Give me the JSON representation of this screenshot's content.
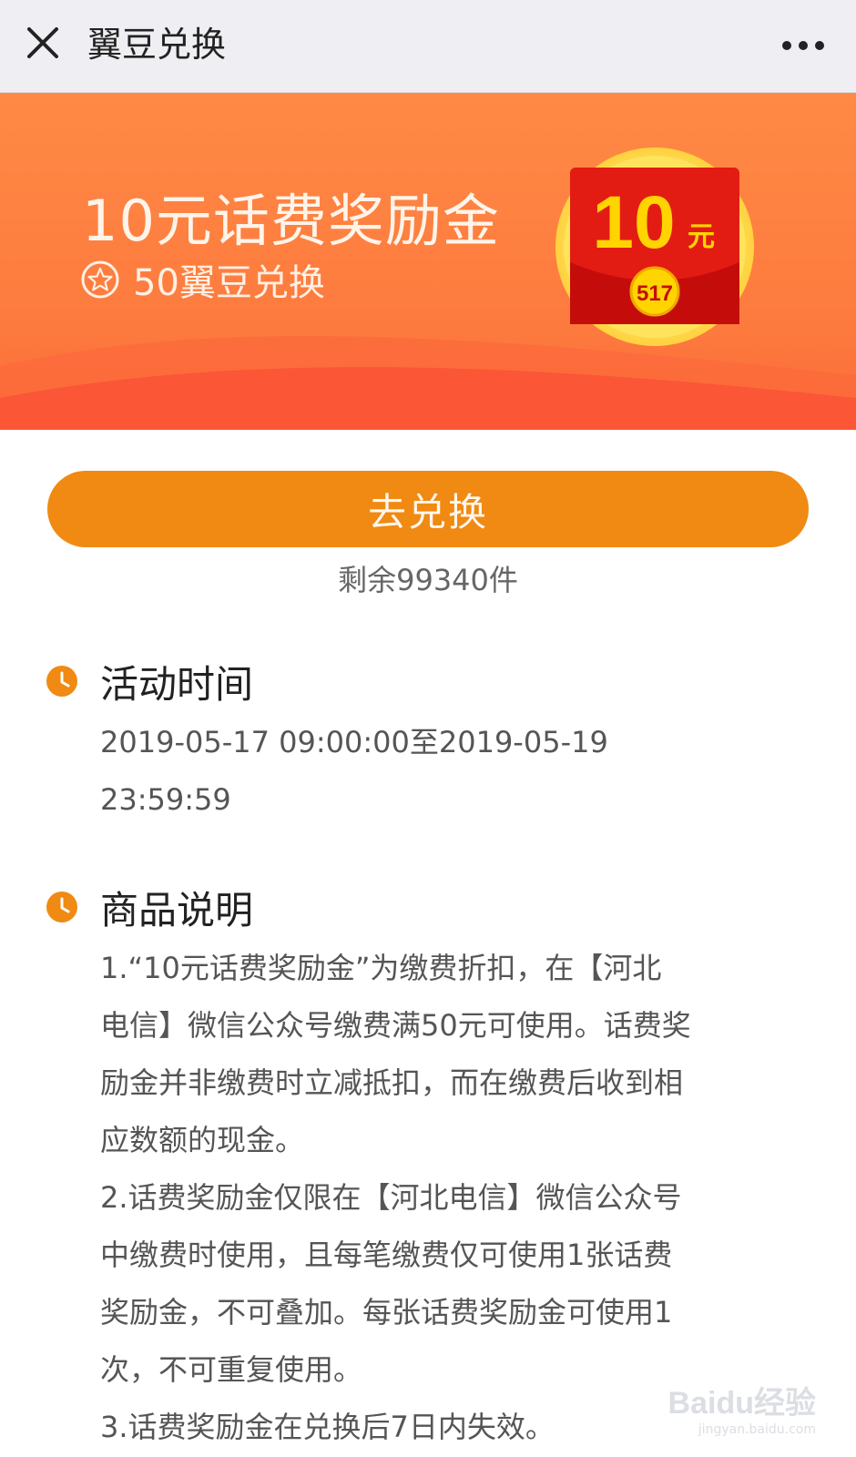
{
  "navbar": {
    "title": "翼豆兑换"
  },
  "banner": {
    "title": "10元话费奖励金",
    "subtitle": "50翼豆兑换",
    "badge_amount": "10",
    "badge_unit": "元",
    "badge_coin": "517"
  },
  "exchange": {
    "button_label": "去兑换",
    "remaining": "剩余99340件"
  },
  "activity_time": {
    "title": "活动时间",
    "lines": [
      "2019-05-17 09:00:00至2019-05-19",
      "23:59:59"
    ]
  },
  "description": {
    "title": "商品说明",
    "lines": [
      "1.“10元话费奖励金”为缴费折扣，在【河北",
      "电信】微信公众号缴费满50元可使用。话费奖",
      "励金并非缴费时立减抵扣，而在缴费后收到相",
      "应数额的现金。",
      "2.话费奖励金仅限在【河北电信】微信公众号",
      "中缴费时使用，且每笔缴费仅可使用1张话费",
      "奖励金，不可叠加。每张话费奖励金可使用1",
      "次，不可重复使用。",
      "3.话费奖励金在兑换后7日内失效。"
    ]
  },
  "watermark": {
    "logo": "Baidu经验",
    "url": "jingyan.baidu.com"
  },
  "colors": {
    "banner": "#fd7a3e",
    "button": "#f08a12",
    "icon": "#f08a12"
  }
}
